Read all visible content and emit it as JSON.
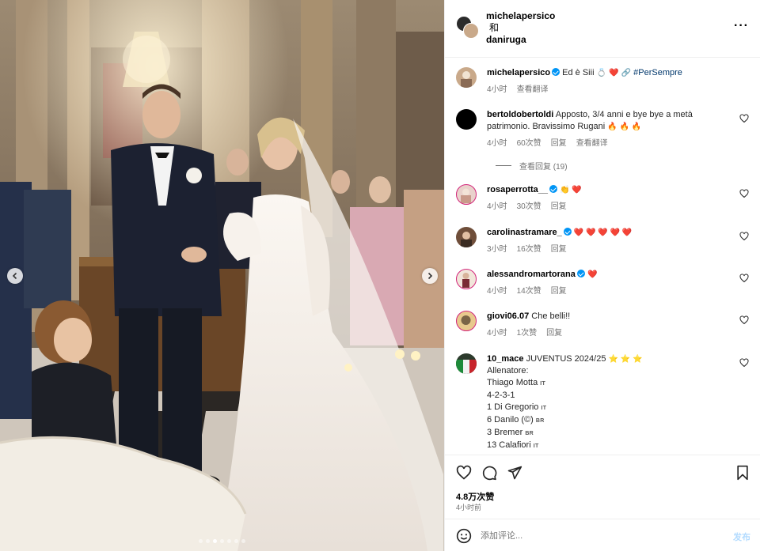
{
  "header": {
    "user1": "michelapersico",
    "and": "和",
    "user2": "daniruga"
  },
  "caption": {
    "user": "michelapersico",
    "text_prefix": "Ed è Siii",
    "emoji_ring": "💍",
    "emoji_heart": "❤️",
    "emoji_link": "🔗",
    "hashtag": "#PerSempre",
    "time": "4小时",
    "translate": "查看翻译"
  },
  "comments": [
    {
      "user": "bertoldobertoldi",
      "text": "Apposto, 3/4 anni e bye bye a metà patrimonio. Bravissimo Rugani",
      "emoji": "🔥 🔥 🔥",
      "time": "4小时",
      "likes": "60次赞",
      "reply": "回复",
      "translate": "查看翻译",
      "view_replies": "查看回复 (19)"
    },
    {
      "user": "rosaperrotta__",
      "emoji": "👏 ❤️",
      "time": "4小时",
      "likes": "30次赞",
      "reply": "回复"
    },
    {
      "user": "carolinastramare_",
      "emoji": "❤️ ❤️ ❤️ ❤️ ❤️",
      "time": "3小时",
      "likes": "16次赞",
      "reply": "回复"
    },
    {
      "user": "alessandromartorana",
      "emoji": "❤️",
      "time": "4小时",
      "likes": "14次赞",
      "reply": "回复"
    },
    {
      "user": "giovi06.07",
      "text": "Che belli!!",
      "time": "4小时",
      "likes": "1次赞",
      "reply": "回复"
    },
    {
      "user": "10_mace",
      "text": "JUVENTUS 2024/25",
      "emoji": "⭐ ⭐ ⭐",
      "lines": [
        {
          "text": "Allenatore:",
          "flag": ""
        },
        {
          "text": "Thiago Motta",
          "flag": "IT"
        },
        {
          "text": "4-2-3-1",
          "flag": ""
        },
        {
          "text": "1 Di Gregorio",
          "flag": "IT"
        },
        {
          "text": "6 Danilo (©)",
          "flag": "BR"
        },
        {
          "text": "3 Bremer",
          "flag": "BR"
        },
        {
          "text": "13 Calafiori",
          "flag": "IT"
        }
      ]
    }
  ],
  "footer": {
    "likes": "4.8万次赞",
    "time": "4小时前",
    "comment_placeholder": "添加评论...",
    "post_label": "发布"
  },
  "colors": {
    "verified": "#0095f6",
    "heart": "#ed4956",
    "muted": "#737373",
    "post_disabled": "#b3dbff"
  },
  "icons": [
    "more-icon",
    "heart-icon",
    "comment-icon",
    "share-icon",
    "bookmark-icon",
    "emoji-icon",
    "chevron-left-icon",
    "chevron-right-icon",
    "verified-icon"
  ]
}
